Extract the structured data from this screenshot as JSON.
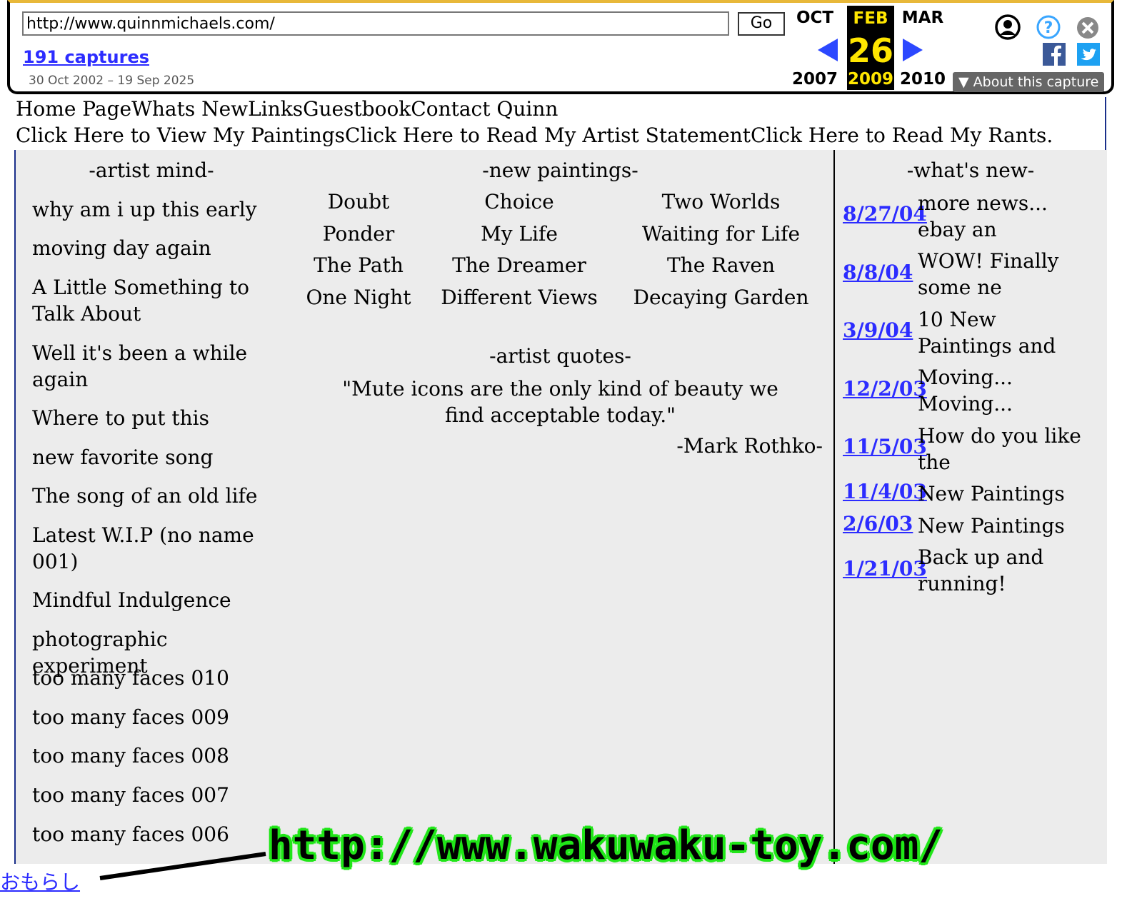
{
  "wayback": {
    "url": "http://www.quinnmichaels.com/",
    "go_label": "Go",
    "captures_label": "191 captures",
    "date_range": "30 Oct 2002 – 19 Sep 2025",
    "prev": {
      "month": "OCT",
      "year": "2007"
    },
    "current": {
      "month": "FEB",
      "day": "26",
      "year": "2009"
    },
    "next": {
      "month": "MAR",
      "year": "2010"
    },
    "about_label": "About this capture",
    "accent_color": "#ffe600",
    "arrow_color": "#2c48ff",
    "icons": [
      "user-icon",
      "help-icon",
      "close-icon",
      "facebook-icon",
      "twitter-icon",
      "caret-down-icon"
    ]
  },
  "nav": {
    "row1": [
      "Home Page",
      "Whats New",
      "Links",
      "Guestbook",
      "Contact Quinn"
    ],
    "row2": [
      "Click Here to View My Paintings",
      "Click Here to Read My Artist Statement",
      "Click Here to Read My Rants."
    ]
  },
  "artist_mind": {
    "heading": "-artist mind-",
    "items": [
      "why am i up this early",
      "moving day again",
      "A Little Something to Talk About",
      "Well it's been a while again",
      "Where to put this",
      "new favorite song",
      "The song of an old life",
      "Latest W.I.P (no name 001)",
      "Mindful Indulgence",
      "photographic experiment",
      "too many faces 010",
      "too many faces 009",
      "too many faces 008",
      "too many faces 007",
      "too many faces 006"
    ]
  },
  "new_paintings": {
    "heading": "-new paintings-",
    "rows": [
      [
        "Doubt",
        "Choice",
        "Two Worlds"
      ],
      [
        "Ponder",
        "My Life",
        "Waiting for Life"
      ],
      [
        "The Path",
        "The Dreamer",
        "The Raven"
      ],
      [
        "One Night",
        "Different Views",
        "Decaying Garden"
      ]
    ]
  },
  "quotes": {
    "heading": "-artist quotes-",
    "text": "\"Mute icons are the only kind of beauty we find acceptable today.\"",
    "author": "-Mark Rothko-"
  },
  "whats_new": {
    "heading": "-what's new-",
    "items": [
      {
        "date": "8/27/04",
        "text": "more news... ebay an"
      },
      {
        "date": "8/8/04",
        "text": "WOW! Finally some ne"
      },
      {
        "date": "3/9/04",
        "text": "10 New Paintings and"
      },
      {
        "date": "12/2/03",
        "text": "Moving... Moving..."
      },
      {
        "date": "11/5/03",
        "text": "How do you like the"
      },
      {
        "date": "11/4/03",
        "text": "New Paintings"
      },
      {
        "date": "2/6/03",
        "text": "New Paintings"
      },
      {
        "date": "1/21/03",
        "text": "Back up and running!"
      }
    ]
  },
  "overlay": {
    "bottom_link": "おもらし",
    "url_text": "http://www.wakuwaku-toy.com/",
    "glow_color": "#22e61a"
  }
}
